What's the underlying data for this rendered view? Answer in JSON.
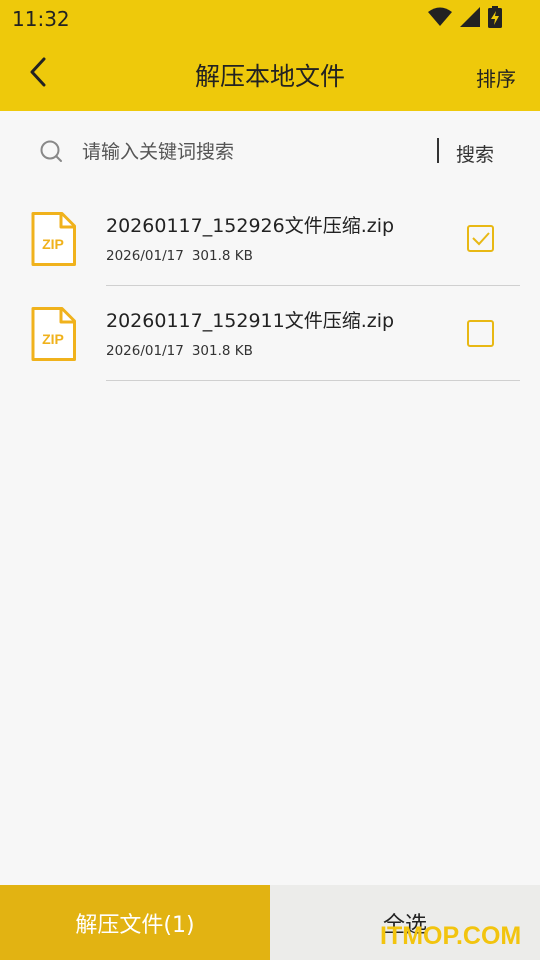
{
  "status_bar": {
    "time": "11:32",
    "icons": [
      "wifi-icon",
      "cell-signal-icon",
      "battery-charging-icon"
    ]
  },
  "header": {
    "title": "解压本地文件",
    "sort_label": "排序",
    "back_icon": "chevron-left-icon",
    "background_color": "#eec90b"
  },
  "search": {
    "placeholder": "请输入关键词搜索",
    "value": "",
    "button_label": "搜索"
  },
  "files": [
    {
      "name": "20260117_152926文件压缩.zip",
      "date": "2026/01/17",
      "size": "301.8 KB",
      "icon": "zip-file-icon",
      "icon_label": "ZIP",
      "checked": true
    },
    {
      "name": "20260117_152911文件压缩.zip",
      "date": "2026/01/17",
      "size": "301.8 KB",
      "icon": "zip-file-icon",
      "icon_label": "ZIP",
      "checked": false
    }
  ],
  "bottom_bar": {
    "extract_label": "解压文件(1)",
    "select_all_label": "全选",
    "accent_color": "#e2b312"
  },
  "watermark": "ITMOP.COM"
}
